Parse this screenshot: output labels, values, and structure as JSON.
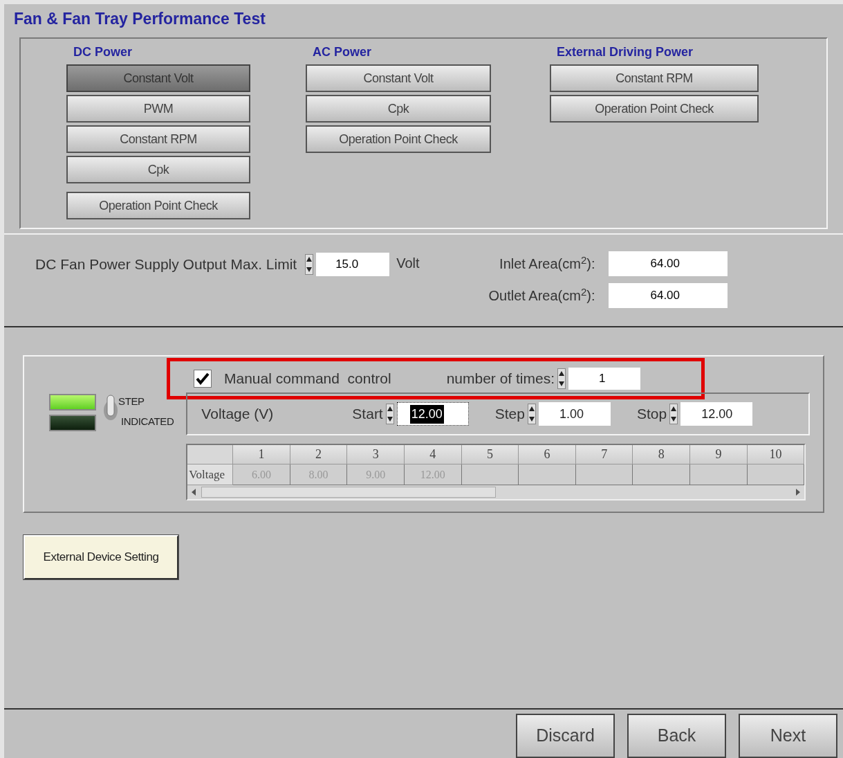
{
  "title": "Fan & Fan Tray Performance Test",
  "groups": [
    {
      "label": "DC Power",
      "buttons": [
        {
          "label": "Constant Volt",
          "selected": true
        },
        {
          "label": "PWM",
          "selected": false
        },
        {
          "label": "Constant RPM",
          "selected": false
        },
        {
          "label": "Cpk",
          "selected": false
        },
        {
          "label": "Operation Point Check",
          "selected": false
        }
      ]
    },
    {
      "label": "AC Power",
      "buttons": [
        {
          "label": "Constant Volt",
          "selected": false
        },
        {
          "label": "Cpk",
          "selected": false
        },
        {
          "label": "Operation Point Check",
          "selected": false
        }
      ]
    },
    {
      "label": "External Driving Power",
      "buttons": [
        {
          "label": "Constant RPM",
          "selected": false
        },
        {
          "label": "Operation Point Check",
          "selected": false
        }
      ]
    }
  ],
  "power_limit": {
    "label": "DC Fan Power Supply Output Max. Limit",
    "value": "15.0",
    "unit": "Volt"
  },
  "areas": [
    {
      "label": "Inlet Area(cm$^{2}$):",
      "value": "64.00"
    },
    {
      "label": "Outlet Area(cm$^{2}$):",
      "value": "64.00"
    }
  ],
  "indicators": [
    {
      "on": true
    },
    {
      "on": false
    }
  ],
  "toggle": {
    "labels": [
      "STEP",
      "INDICATED"
    ]
  },
  "manual_control": {
    "label": "Manual command  control",
    "checked": true,
    "highlighted": true,
    "times_label": "number of times:",
    "times_value": "1"
  },
  "voltage": {
    "label": "Voltage (V)",
    "fields": [
      {
        "label": "Start",
        "value": "12.00",
        "selected": true
      },
      {
        "label": "Step",
        "value": "1.00",
        "selected": false
      },
      {
        "label": "Stop",
        "value": "12.00",
        "selected": false
      }
    ]
  },
  "table": {
    "columns": [
      "1",
      "2",
      "3",
      "4",
      "5",
      "6",
      "7",
      "8",
      "9",
      "10"
    ],
    "rows": [
      {
        "header": "Voltage",
        "cells": [
          "6.00",
          "8.00",
          "9.00",
          "12.00"
        ]
      }
    ]
  },
  "external_button": "External Device Setting",
  "footer_buttons": [
    "Discard",
    "Back",
    "Next"
  ]
}
